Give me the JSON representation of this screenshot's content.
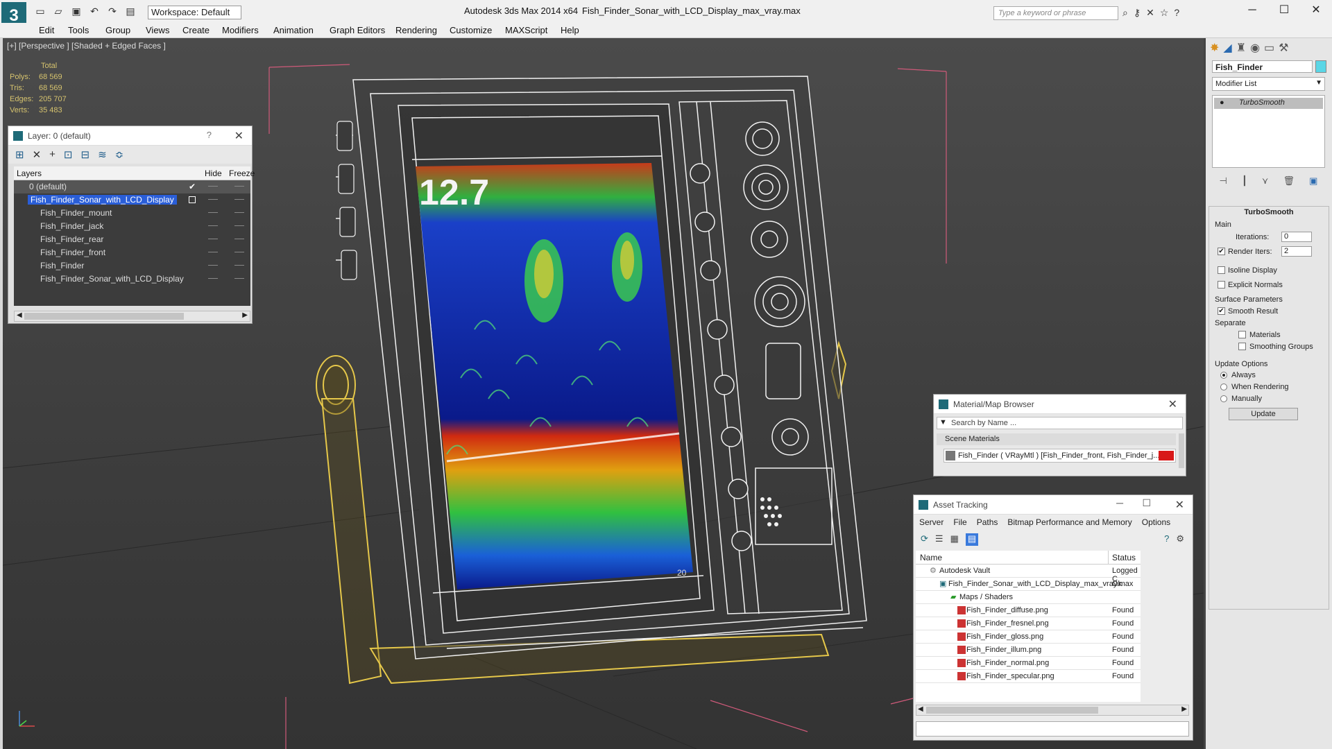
{
  "window": {
    "app_title": "Autodesk 3ds Max  2014 x64",
    "file_title": "Fish_Finder_Sonar_with_LCD_Display_max_vray.max",
    "workspace": "Workspace: Default",
    "search_placeholder": "Type a keyword or phrase",
    "logo": "3"
  },
  "menu": [
    "Edit",
    "Tools",
    "Group",
    "Views",
    "Create",
    "Modifiers",
    "Animation",
    "Graph Editors",
    "Rendering",
    "Customize",
    "MAXScript",
    "Help"
  ],
  "viewport": {
    "label": "[+] [Perspective ] [Shaded + Edged Faces ]",
    "stats_header": "Total",
    "stats": [
      {
        "label": "Polys:",
        "value": "68 569"
      },
      {
        "label": "Tris:",
        "value": "68 569"
      },
      {
        "label": "Edges:",
        "value": "205 707"
      },
      {
        "label": "Verts:",
        "value": "35 483"
      }
    ],
    "lcd_depth": "12.7",
    "lcd_bottom": "20"
  },
  "layer_panel": {
    "title": "Layer: 0 (default)",
    "help": "?",
    "col_layers": "Layers",
    "col_hide": "Hide",
    "col_freeze": "Freeze",
    "rows": [
      {
        "label": "0 (default)"
      },
      {
        "label": "Fish_Finder_Sonar_with_LCD_Display"
      },
      {
        "label": "Fish_Finder_mount"
      },
      {
        "label": "Fish_Finder_jack"
      },
      {
        "label": "Fish_Finder_rear"
      },
      {
        "label": "Fish_Finder_front"
      },
      {
        "label": "Fish_Finder"
      },
      {
        "label": "Fish_Finder_Sonar_with_LCD_Display"
      }
    ]
  },
  "command_panel": {
    "object_name": "Fish_Finder",
    "modifier_list": "Modifier List",
    "stack_item": "TurboSmooth",
    "rollout_title": "TurboSmooth",
    "main": "Main",
    "iterations_label": "Iterations:",
    "iterations_value": "0",
    "render_iters_label": "Render Iters:",
    "render_iters_value": "2",
    "isoline": "Isoline Display",
    "explicit_normals": "Explicit Normals",
    "surface_params": "Surface Parameters",
    "smooth_result": "Smooth Result",
    "separate": "Separate",
    "materials": "Materials",
    "smoothing_groups": "Smoothing Groups",
    "update_options": "Update Options",
    "always": "Always",
    "when_rendering": "When Rendering",
    "manually": "Manually",
    "update_btn": "Update"
  },
  "material_browser": {
    "title": "Material/Map Browser",
    "search_placeholder": "Search by Name ...",
    "section": "Scene Materials",
    "item": "Fish_Finder ( VRayMtl ) [Fish_Finder_front, Fish_Finder_j..."
  },
  "asset_tracking": {
    "title": "Asset Tracking",
    "menu": [
      "Server",
      "File",
      "Paths",
      "Bitmap Performance and Memory",
      "Options"
    ],
    "col_name": "Name",
    "col_status": "Status",
    "rows": [
      {
        "name": "Autodesk Vault",
        "status": "Logged C"
      },
      {
        "name": "Fish_Finder_Sonar_with_LCD_Display_max_vray.max",
        "status": "Ok"
      },
      {
        "name": "Maps / Shaders",
        "status": ""
      },
      {
        "name": "Fish_Finder_diffuse.png",
        "status": "Found"
      },
      {
        "name": "Fish_Finder_fresnel.png",
        "status": "Found"
      },
      {
        "name": "Fish_Finder_gloss.png",
        "status": "Found"
      },
      {
        "name": "Fish_Finder_illum.png",
        "status": "Found"
      },
      {
        "name": "Fish_Finder_normal.png",
        "status": "Found"
      },
      {
        "name": "Fish_Finder_specular.png",
        "status": "Found"
      }
    ]
  },
  "colors": {
    "accent": "#1e6a78",
    "selection": "#2a5ed8",
    "wire_white": "#ffffff",
    "wire_yellow": "#e6c84a",
    "stats_text": "#d6c36e"
  }
}
